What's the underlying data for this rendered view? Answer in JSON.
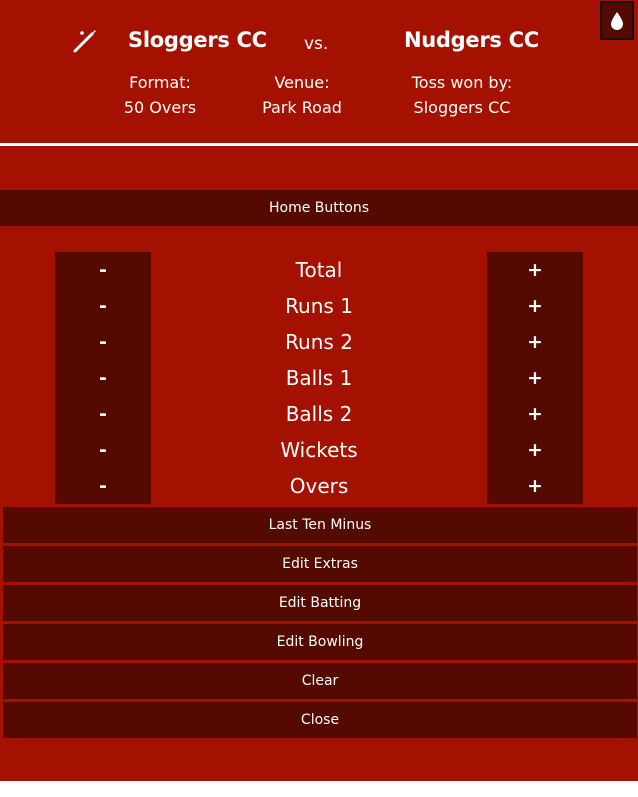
{
  "colors": {
    "panel": "#a51100",
    "dark": "#550a00",
    "text": "#ffffff"
  },
  "header": {
    "home_team": "Sloggers CC",
    "vs": "vs.",
    "away_team": "Nudgers CC",
    "format_label": "Format:",
    "format_value": "50 Overs",
    "venue_label": "Venue:",
    "venue_value": "Park Road",
    "toss_label": "Toss won by:",
    "toss_value": "Sloggers CC",
    "theme_icon": "droplet-icon",
    "batting_icon": "cricket-bat-icon"
  },
  "home_buttons_label": "Home Buttons",
  "score_rows": [
    {
      "label": "Total",
      "minus": "-",
      "plus": "+"
    },
    {
      "label": "Runs 1",
      "minus": "-",
      "plus": "+"
    },
    {
      "label": "Runs 2",
      "minus": "-",
      "plus": "+"
    },
    {
      "label": "Balls 1",
      "minus": "-",
      "plus": "+"
    },
    {
      "label": "Balls 2",
      "minus": "-",
      "plus": "+"
    },
    {
      "label": "Wickets",
      "minus": "-",
      "plus": "+"
    },
    {
      "label": "Overs",
      "minus": "-",
      "plus": "+"
    }
  ],
  "actions": [
    {
      "label": "Last Ten Minus"
    },
    {
      "label": "Edit Extras"
    },
    {
      "label": "Edit Batting"
    },
    {
      "label": "Edit Bowling"
    },
    {
      "label": "Clear"
    },
    {
      "label": "Close"
    }
  ]
}
